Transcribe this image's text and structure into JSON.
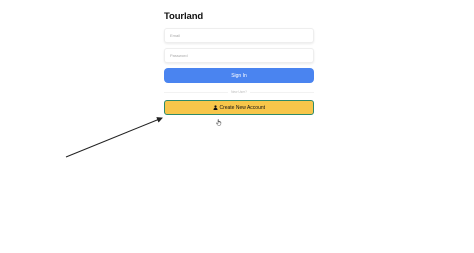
{
  "app": {
    "brand": "Tourland"
  },
  "login_form": {
    "email_placeholder": "Email",
    "password_placeholder": "Password",
    "signin_label": "Sign In",
    "divider_text": "New User?",
    "create_account_label": "Create New Account"
  },
  "icons": {
    "create_account_icon": "user-icon",
    "pointer": "hand-cursor-icon",
    "annotation": "arrow-annotation"
  },
  "colors": {
    "signin_button": "#4a84f0",
    "create_button": "#f7c64a",
    "create_button_border": "#2f8a6a"
  }
}
